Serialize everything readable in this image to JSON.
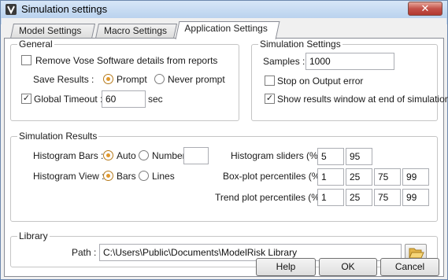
{
  "window": {
    "title": "Simulation settings",
    "close_glyph": "✕"
  },
  "tabs": [
    {
      "label": "Model Settings"
    },
    {
      "label": "Macro Settings"
    },
    {
      "label": "Application Settings"
    }
  ],
  "general": {
    "title": "General",
    "remove_vose_label": "Remove Vose Software details from reports",
    "remove_vose_checked": false,
    "save_results_label": "Save Results :",
    "save_options": [
      "Prompt",
      "Never prompt"
    ],
    "save_selected": "Prompt",
    "global_timeout_label": "Global Timeout :",
    "global_timeout_checked": true,
    "global_timeout_value": "60",
    "timeout_unit": "sec"
  },
  "simulation_settings": {
    "title": "Simulation Settings",
    "samples_label": "Samples :",
    "samples_value": "1000",
    "stop_on_error_label": "Stop on Output error",
    "stop_on_error_checked": false,
    "show_results_label": "Show results window at end of simulation",
    "show_results_checked": true
  },
  "simulation_results": {
    "title": "Simulation Results",
    "histogram_bars_label": "Histogram Bars :",
    "bars_options": [
      "Auto",
      "Number"
    ],
    "bars_selected": "Auto",
    "bars_number_value": "",
    "histogram_view_label": "Histogram View :",
    "view_options": [
      "Bars",
      "Lines"
    ],
    "view_selected": "Bars",
    "histogram_sliders_label": "Histogram sliders (%) :",
    "histogram_sliders": [
      "5",
      "95"
    ],
    "boxplot_label": "Box-plot percentiles (%) :",
    "boxplot_percentiles": [
      "1",
      "25",
      "75",
      "99"
    ],
    "trend_label": "Trend plot percentiles (%) :",
    "trend_percentiles": [
      "1",
      "25",
      "75",
      "99"
    ]
  },
  "library": {
    "title": "Library",
    "path_label": "Path :",
    "path_value": "C:\\Users\\Public\\Documents\\ModelRisk Library"
  },
  "footer": {
    "help_label": "Help",
    "ok_label": "OK",
    "cancel_label": "Cancel"
  },
  "icons": {
    "window": "vose-app-icon",
    "folder": "folder-open-icon",
    "close": "close-icon"
  },
  "colors": {
    "radio_selected": "#e0982c",
    "title_bar": "#bad2ee",
    "close_button": "#c4524a"
  }
}
